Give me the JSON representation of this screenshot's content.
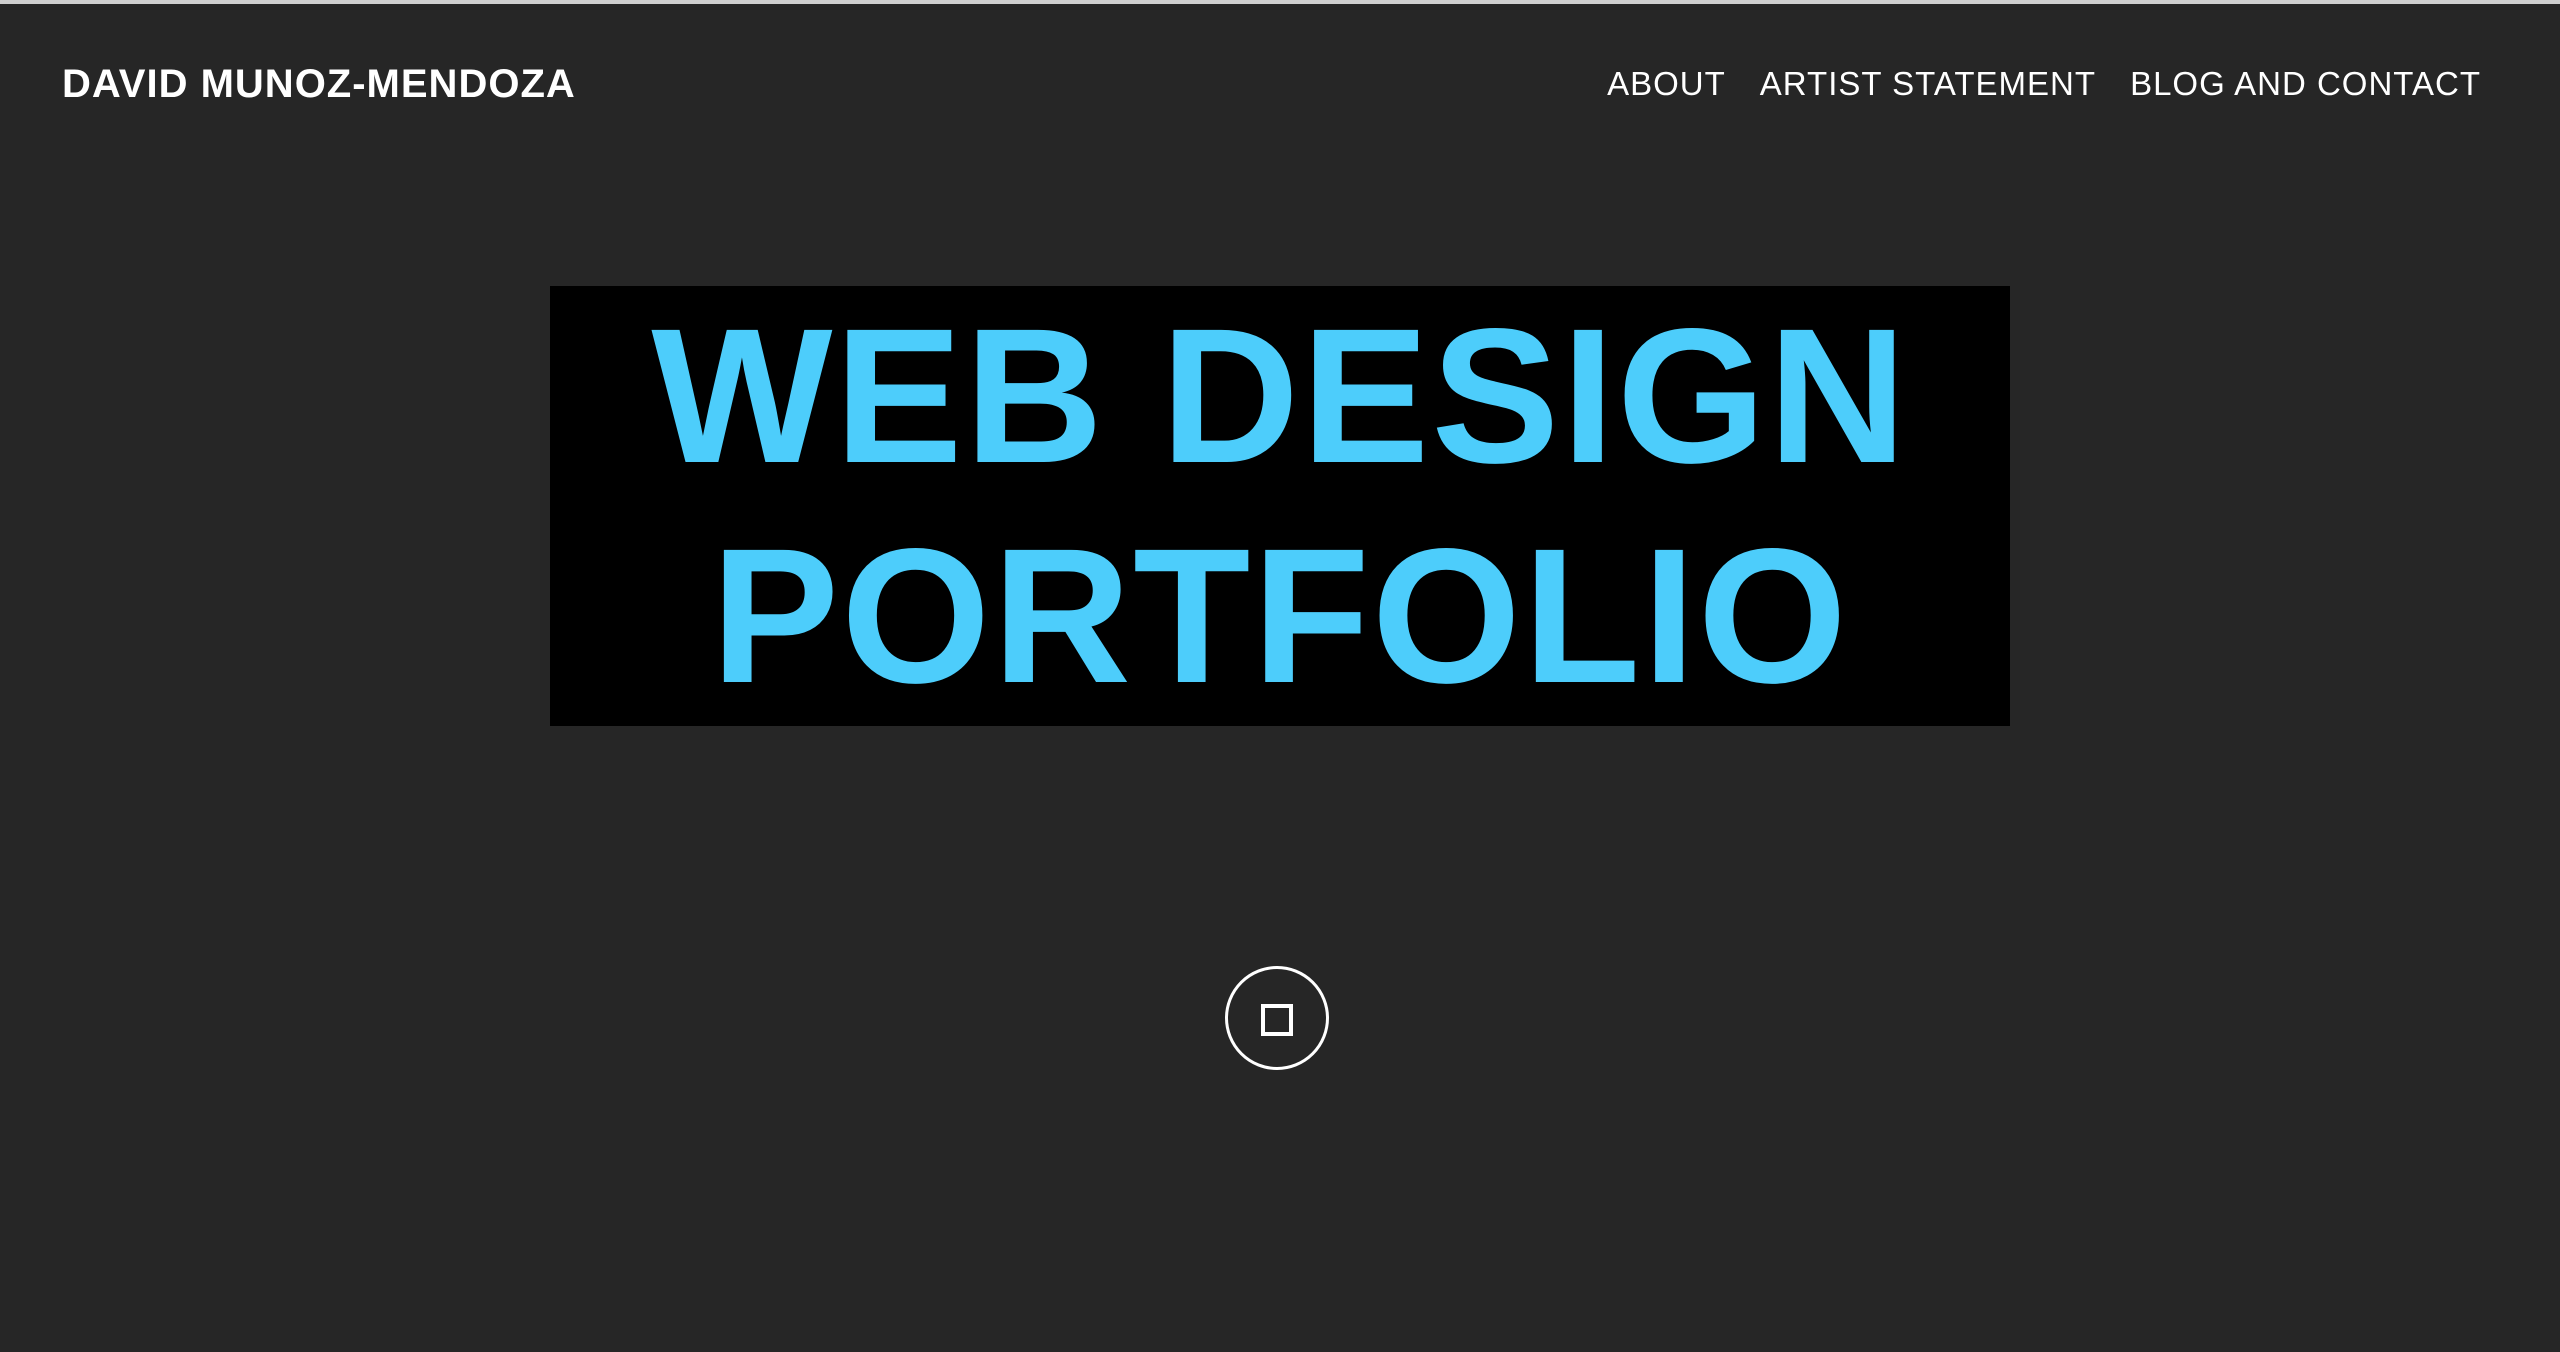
{
  "header": {
    "site_title": "DAVID MUNOZ-MENDOZA",
    "nav": [
      {
        "label": "ABOUT"
      },
      {
        "label": "ARTIST STATEMENT"
      },
      {
        "label": "BLOG AND CONTACT"
      }
    ]
  },
  "hero": {
    "line1": "WEB DESIGN",
    "line2": "PORTFOLIO",
    "text_color": "#4dcdfb",
    "box_color": "#000000"
  },
  "page": {
    "background_color": "#262626"
  },
  "scroll_button": {
    "icon": "square-icon"
  }
}
